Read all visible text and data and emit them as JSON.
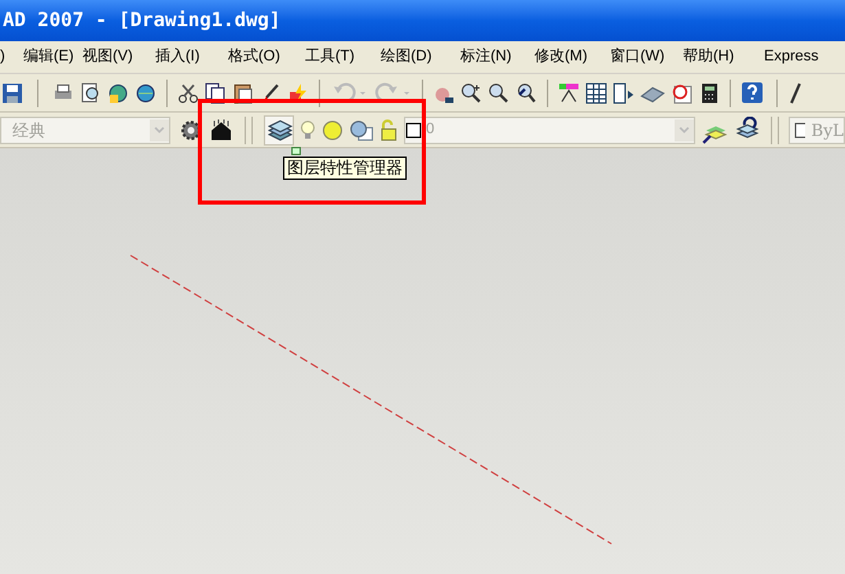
{
  "window": {
    "title": "AD 2007 - [Drawing1.dwg]"
  },
  "menu": [
    {
      "label": ")"
    },
    {
      "label": "编辑(E)"
    },
    {
      "label": "视图(V)"
    },
    {
      "label": "插入(I)"
    },
    {
      "label": "格式(O)"
    },
    {
      "label": "工具(T)"
    },
    {
      "label": "绘图(D)"
    },
    {
      "label": "标注(N)"
    },
    {
      "label": "修改(M)"
    },
    {
      "label": "窗口(W)"
    },
    {
      "label": "帮助(H)"
    },
    {
      "label": "Express"
    }
  ],
  "workspace_combo": {
    "value": "经典"
  },
  "layer_combo": {
    "value": "0"
  },
  "color_combo": {
    "value": "ByL"
  },
  "tooltip": {
    "text": "图层特性管理器"
  }
}
